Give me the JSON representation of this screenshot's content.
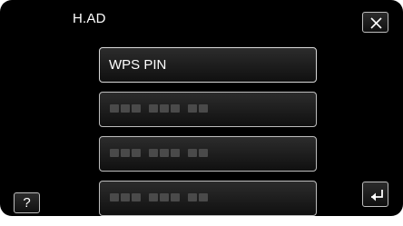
{
  "header": {
    "title": "H.AD",
    "close_icon": "close-icon"
  },
  "list": {
    "items": [
      {
        "label": "WPS PIN"
      },
      {
        "label": "",
        "masked": true
      },
      {
        "label": "",
        "masked": true
      },
      {
        "label": "",
        "masked": true
      }
    ]
  },
  "footer": {
    "help_label": "?",
    "back_icon": "return-icon"
  },
  "colors": {
    "background": "#000000",
    "button_border": "#bdbdbd",
    "text": "#ffffff",
    "masked_text": "#4a4a4a"
  }
}
